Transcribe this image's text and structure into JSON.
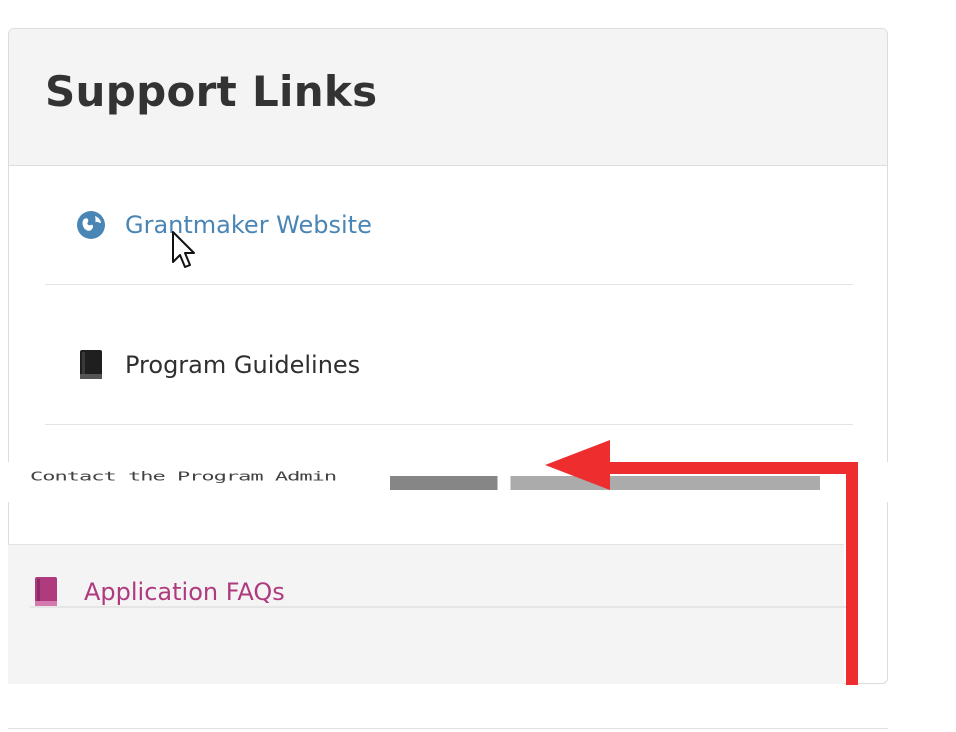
{
  "panel": {
    "title": "Support Links"
  },
  "links": [
    {
      "label": "Grantmaker Website",
      "icon": "globe-icon",
      "color": "#4a86b5"
    },
    {
      "label": "Program Guidelines",
      "icon": "book-icon",
      "color": "#2f2f2f"
    },
    {
      "label": "Contact the Program Admin",
      "icon": "envelope-icon",
      "color": "#2f2f2f"
    }
  ],
  "faq": {
    "label": "Application FAQs",
    "icon": "book-icon",
    "color": "#b03a7e"
  },
  "annotation": {
    "arrow_color": "#ee2e2e"
  }
}
